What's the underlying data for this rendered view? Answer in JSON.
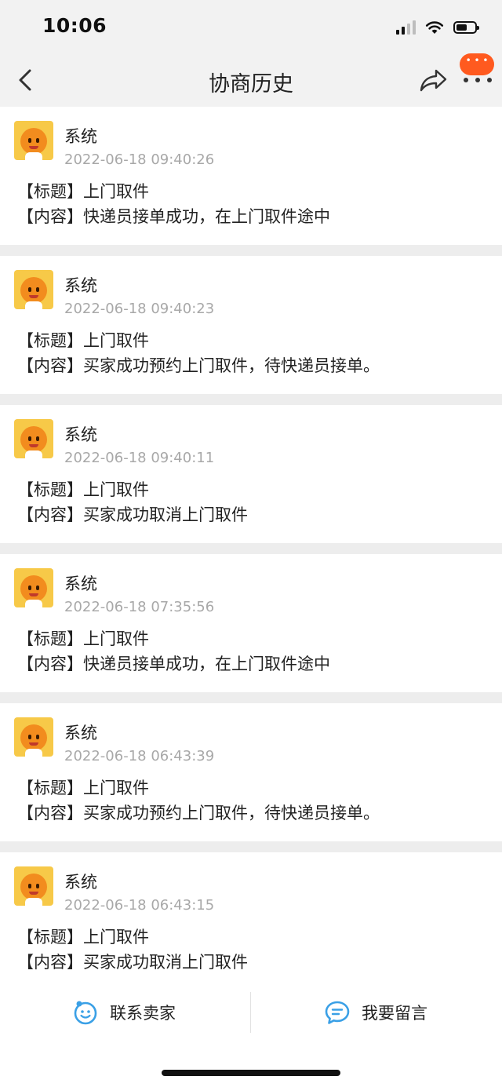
{
  "status_bar": {
    "time": "10:06",
    "icons": [
      "signal-icon",
      "wifi-icon",
      "battery-icon"
    ]
  },
  "nav": {
    "title": "协商历史",
    "back_icon": "chevron-left-icon",
    "share_icon": "share-icon",
    "more_icon": "more-icon",
    "accent": "#ff5a1f"
  },
  "messages": [
    {
      "sender": "系统",
      "timestamp": "2022-06-18 09:40:26",
      "title_line": "【标题】上门取件",
      "content_line": "【内容】快递员接单成功，在上门取件途中"
    },
    {
      "sender": "系统",
      "timestamp": "2022-06-18 09:40:23",
      "title_line": "【标题】上门取件",
      "content_line": "【内容】买家成功预约上门取件，待快递员接单。"
    },
    {
      "sender": "系统",
      "timestamp": "2022-06-18 09:40:11",
      "title_line": "【标题】上门取件",
      "content_line": "【内容】买家成功取消上门取件"
    },
    {
      "sender": "系统",
      "timestamp": "2022-06-18 07:35:56",
      "title_line": "【标题】上门取件",
      "content_line": "【内容】快递员接单成功，在上门取件途中"
    },
    {
      "sender": "系统",
      "timestamp": "2022-06-18 06:43:39",
      "title_line": "【标题】上门取件",
      "content_line": "【内容】买家成功预约上门取件，待快递员接单。"
    },
    {
      "sender": "系统",
      "timestamp": "2022-06-18 06:43:15",
      "title_line": "【标题】上门取件",
      "content_line": "【内容】买家成功取消上门取件"
    }
  ],
  "bottom_bar": {
    "contact_seller": {
      "label": "联系卖家",
      "icon": "smile-chat-icon"
    },
    "leave_message": {
      "label": "我要留言",
      "icon": "message-bubble-icon"
    },
    "icon_color": "#3aa0e6"
  }
}
